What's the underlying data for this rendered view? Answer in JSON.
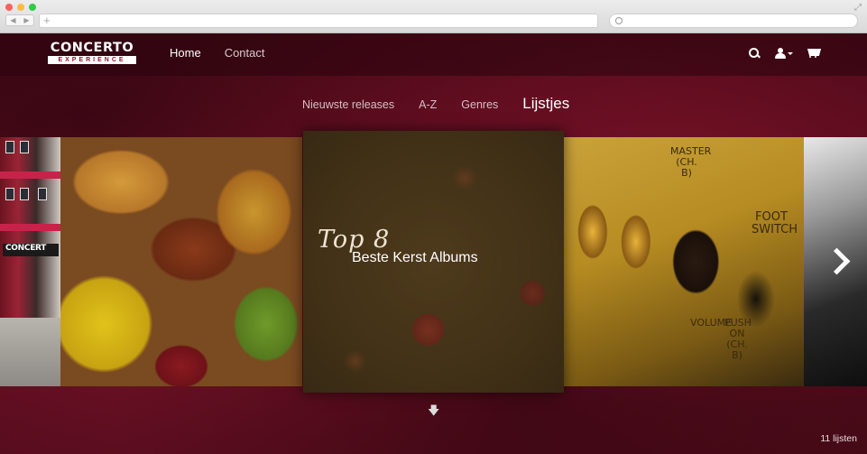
{
  "browser": {
    "url_placeholder": "+"
  },
  "header": {
    "logo_top": "CONCERTO",
    "logo_bottom": "EXPERIENCE",
    "nav": [
      {
        "label": "Home",
        "active": true
      },
      {
        "label": "Contact",
        "active": false
      }
    ],
    "icons": [
      "search-icon",
      "user-icon",
      "cart-icon"
    ]
  },
  "subnav": [
    {
      "label": "Nieuwste releases",
      "active": false
    },
    {
      "label": "A-Z",
      "active": false
    },
    {
      "label": "Genres",
      "active": false
    },
    {
      "label": "Lijstjes",
      "active": true
    }
  ],
  "carousel": {
    "building_sign": "CONCERT",
    "featured": {
      "top": "Top 8",
      "title": "Beste Kerst Albums"
    },
    "amp_labels": {
      "master": "MASTER (CH. B)",
      "foot": "FOOT SWITCH",
      "volume": "VOLUME",
      "push": "PUSH ON (CH. B)"
    }
  },
  "footer": {
    "count": "11 lijsten"
  },
  "colors": {
    "accent": "#5e0e20",
    "text": "#ffffff"
  }
}
